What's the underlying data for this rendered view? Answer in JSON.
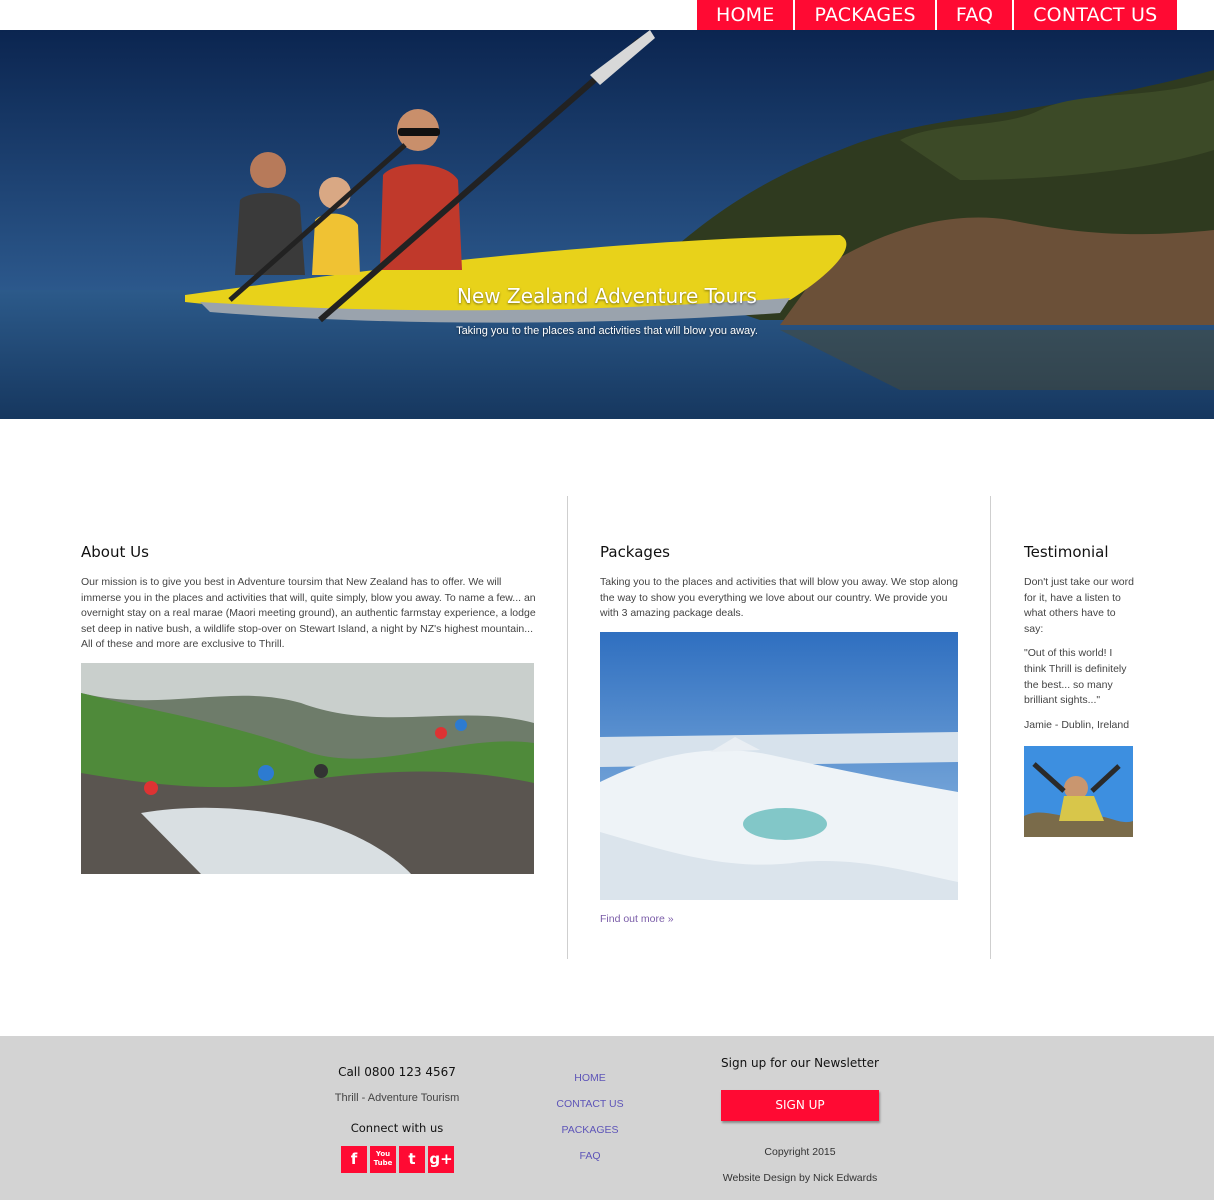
{
  "nav": {
    "items": [
      "HOME",
      "PACKAGES",
      "FAQ",
      "CONTACT US"
    ]
  },
  "hero": {
    "title": "New Zealand Adventure Tours",
    "subtitle": "Taking you to the places and activities that will blow you away."
  },
  "about": {
    "heading": "About Us",
    "text": "Our mission is to give you best in Adventure toursim that New Zealand has to offer. We will immerse you in the places and activities that will, quite simply, blow you away. To name a few... an overnight stay on a real marae (Maori meeting ground), an authentic farmstay experience, a lodge set deep in native bush, a wildlife stop-over on Stewart Island, a night by NZ's highest mountain... All of these and more are exclusive to Thrill."
  },
  "packages": {
    "heading": "Packages",
    "text": "Taking you to the places and activities that will blow you away. We stop along the way to show you everything we love about our country. We provide you with 3 amazing package deals.",
    "link": "Find out more »"
  },
  "testimonial": {
    "heading": "Testimonial",
    "intro": "Don't just take our word for it, have a listen to what others have to say:",
    "quote": "\"Out of this world! I think Thrill is definitely the best... so many brilliant sights...\"",
    "author": "Jamie - Dublin, Ireland"
  },
  "footer": {
    "call": "Call 0800 123 4567",
    "company": "Thrill - Adventure Tourism",
    "connect": "Connect with us",
    "social": [
      "facebook-icon",
      "youtube-icon",
      "twitter-icon",
      "google-plus-icon"
    ],
    "social_glyphs": {
      "facebook": "f",
      "youtube_top": "You",
      "youtube_bottom": "Tube",
      "twitter": "t",
      "google": "g+"
    },
    "links": [
      "HOME",
      "CONTACT US",
      "PACKAGES",
      "FAQ"
    ],
    "newsletter": "Sign up for our Newsletter",
    "signup": "SIGN UP",
    "copyright": "Copyright 2015",
    "credit": "Website Design by Nick Edwards"
  },
  "colors": {
    "accent": "#ff0a33",
    "footer_bg": "#d3d3d3",
    "link": "#7a5ca8"
  }
}
